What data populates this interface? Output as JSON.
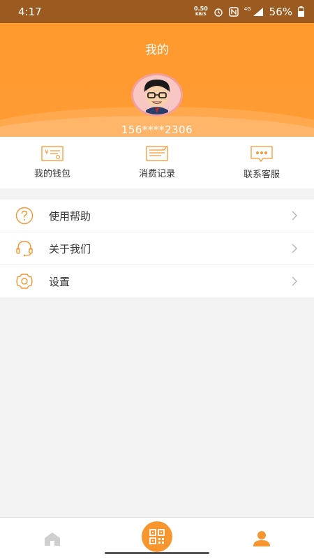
{
  "status": {
    "time": "4:17",
    "net_speed": "0.50",
    "net_unit": "KB/S",
    "network": "4G",
    "battery": "56%"
  },
  "header": {
    "title": "我的",
    "phone": "156****2306"
  },
  "quick_actions": [
    {
      "label": "我的钱包",
      "icon": "wallet-icon"
    },
    {
      "label": "消费记录",
      "icon": "records-icon"
    },
    {
      "label": "联系客服",
      "icon": "chat-icon"
    }
  ],
  "menu": [
    {
      "label": "使用帮助",
      "icon": "help-icon"
    },
    {
      "label": "关于我们",
      "icon": "headset-icon"
    },
    {
      "label": "设置",
      "icon": "gear-icon"
    }
  ],
  "colors": {
    "accent": "#f7962f",
    "header": "#ff9a2e",
    "statusbar": "#9b5a1f",
    "tab_inactive": "#cfcfcf"
  }
}
